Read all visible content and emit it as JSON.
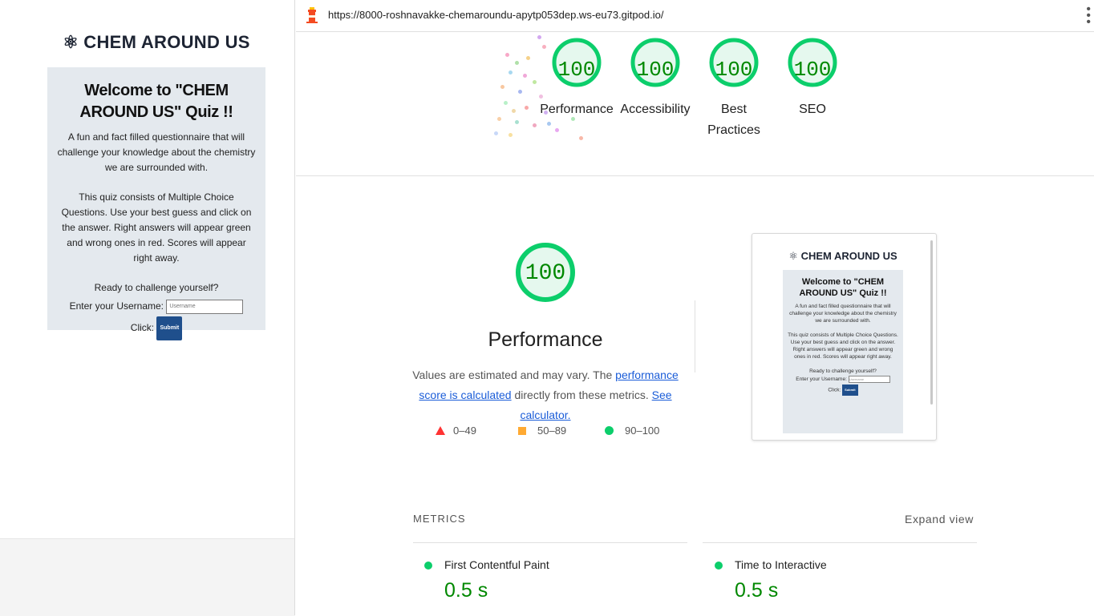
{
  "preview": {
    "site_title": "CHEM AROUND US",
    "atom_icon": "atom-icon",
    "heading": "Welcome to \"CHEM AROUND US\" Quiz !!",
    "intro": "A fun and fact filled questionnaire that will challenge your knowledge about the chemistry we are surrounded with.",
    "instructions": "This quiz consists of Multiple Choice Questions. Use your best guess and click on the answer. Right answers will appear green and wrong ones in red. Scores will appear right away.",
    "ready": "Ready to challenge yourself?",
    "username_label": "Enter your Username:",
    "username_placeholder": "Username",
    "click_label": "Click:",
    "submit_label": "Submit"
  },
  "url_bar": {
    "url": "https://8000-roshnavakke-chemaroundu-apytp053dep.ws-eu73.gitpod.io/",
    "menu_icon": "kebab-menu-icon"
  },
  "categories": [
    {
      "score": "100",
      "label": "Performance"
    },
    {
      "score": "100",
      "label": "Accessibility"
    },
    {
      "score": "100",
      "label": "Best Practices"
    },
    {
      "score": "100",
      "label": "SEO"
    }
  ],
  "performance": {
    "score": "100",
    "title": "Performance",
    "desc_prefix": "Values are estimated and may vary. The ",
    "link_score": "performance score is calculated",
    "desc_middle": " directly from these metrics. ",
    "link_calculator": "See calculator."
  },
  "legend": {
    "fail": "0–49",
    "average": "50–89",
    "pass": "90–100"
  },
  "metrics": {
    "heading": "METRICS",
    "expand": "Expand view",
    "items": [
      {
        "label": "First Contentful Paint",
        "value": "0.5 s"
      },
      {
        "label": "Time to Interactive",
        "value": "0.5 s"
      }
    ]
  },
  "colors": {
    "pass": "#0cce6b",
    "pass_text": "#008800",
    "average": "#ffaa33",
    "fail": "#ff3333",
    "link": "#1a5cd8",
    "submit": "#1f4f8c",
    "card_bg": "#e4e9ee"
  }
}
